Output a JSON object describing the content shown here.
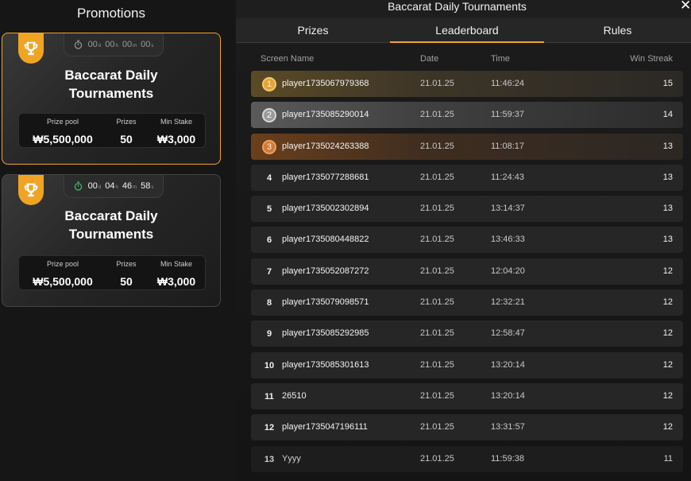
{
  "left_panel": {
    "title": "Promotions",
    "cards": [
      {
        "title_line1": "Baccarat Daily",
        "title_line2": "Tournaments",
        "timer": {
          "d": "00",
          "h": "00",
          "m": "00",
          "s": "00",
          "d_unit": "d",
          "h_unit": "h",
          "m_unit": "m",
          "s_unit": "s"
        },
        "prize_pool_label": "Prize pool",
        "prize_pool": "₩5,500,000",
        "prizes_label": "Prizes",
        "prizes": "50",
        "min_stake_label": "Min Stake",
        "min_stake": "₩3,000"
      },
      {
        "title_line1": "Baccarat Daily",
        "title_line2": "Tournaments",
        "timer": {
          "d": "00",
          "h": "04",
          "m": "46",
          "s": "58",
          "d_unit": "d",
          "h_unit": "h",
          "m_unit": "m",
          "s_unit": "s"
        },
        "prize_pool_label": "Prize pool",
        "prize_pool": "₩5,500,000",
        "prizes_label": "Prizes",
        "prizes": "50",
        "min_stake_label": "Min Stake",
        "min_stake": "₩3,000"
      }
    ]
  },
  "right_panel": {
    "title": "Baccarat Daily Tournaments",
    "close_icon": "close-icon",
    "tabs": [
      {
        "label": "Prizes"
      },
      {
        "label": "Leaderboard"
      },
      {
        "label": "Rules"
      }
    ],
    "active_tab": "Leaderboard",
    "columns": {
      "name": "Screen Name",
      "date": "Date",
      "time": "Time",
      "streak": "Win Streak"
    },
    "rows": [
      {
        "rank": "1",
        "name": "player1735067979368",
        "date": "21.01.25",
        "time": "11:46:24",
        "streak": "15"
      },
      {
        "rank": "2",
        "name": "player1735085290014",
        "date": "21.01.25",
        "time": "11:59:37",
        "streak": "14"
      },
      {
        "rank": "3",
        "name": "player1735024263388",
        "date": "21.01.25",
        "time": "11:08:17",
        "streak": "13"
      },
      {
        "rank": "4",
        "name": "player1735077288681",
        "date": "21.01.25",
        "time": "11:24:43",
        "streak": "13"
      },
      {
        "rank": "5",
        "name": "player1735002302894",
        "date": "21.01.25",
        "time": "13:14:37",
        "streak": "13"
      },
      {
        "rank": "6",
        "name": "player1735080448822",
        "date": "21.01.25",
        "time": "13:46:33",
        "streak": "13"
      },
      {
        "rank": "7",
        "name": "player1735052087272",
        "date": "21.01.25",
        "time": "12:04:20",
        "streak": "12"
      },
      {
        "rank": "8",
        "name": "player1735079098571",
        "date": "21.01.25",
        "time": "12:32:21",
        "streak": "12"
      },
      {
        "rank": "9",
        "name": "player1735085292985",
        "date": "21.01.25",
        "time": "12:58:47",
        "streak": "12"
      },
      {
        "rank": "10",
        "name": "player1735085301613",
        "date": "21.01.25",
        "time": "13:20:14",
        "streak": "12"
      },
      {
        "rank": "11",
        "name": "26510",
        "date": "21.01.25",
        "time": "13:20:14",
        "streak": "12"
      },
      {
        "rank": "12",
        "name": "player1735047196111",
        "date": "21.01.25",
        "time": "13:31:57",
        "streak": "12"
      },
      {
        "rank": "13",
        "name": "Yyyy",
        "date": "21.01.25",
        "time": "11:59:38",
        "streak": "11"
      }
    ]
  },
  "colors": {
    "accent": "#f0a424",
    "gold": "#e2a43a",
    "silver": "#9a9a9a",
    "bronze": "#d07a33",
    "timer_live": "#3ec46d"
  }
}
